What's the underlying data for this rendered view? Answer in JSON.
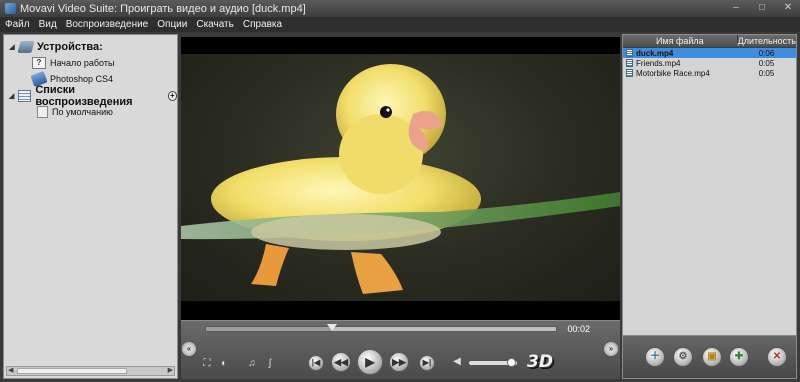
{
  "window": {
    "title": "Movavi Video Suite: Проиграть видео и аудио [duck.mp4]",
    "minimize": "–",
    "maximize": "□",
    "close": "✕"
  },
  "menu": [
    "Файл",
    "Вид",
    "Воспроизведение",
    "Опции",
    "Скачать",
    "Справка"
  ],
  "sidebar": {
    "devices_label": "Устройства:",
    "devices": [
      {
        "label": "Начало работы",
        "icon": "help-icon"
      },
      {
        "label": "Photoshop CS4",
        "icon": "photoshop-icon"
      }
    ],
    "playlists_label": "Списки воспроизведения",
    "playlists": [
      {
        "label": "По умолчанию",
        "icon": "document-icon"
      }
    ]
  },
  "player": {
    "time": "00:02",
    "progress": 0.36,
    "volume": 0.9,
    "badge_3d": "3D"
  },
  "playlist_table": {
    "headers": [
      "Имя файла",
      "Длительность"
    ],
    "rows": [
      {
        "name": "duck.mp4",
        "duration": "0:06",
        "selected": true
      },
      {
        "name": "Friends.mp4",
        "duration": "0:05",
        "selected": false
      },
      {
        "name": "Motorbike Race.mp4",
        "duration": "0:05",
        "selected": false
      }
    ]
  },
  "colors": {
    "selection": "#3d8ee0",
    "panel_bg": "#d9d9d9",
    "chrome_dark": "#3a3a3a"
  }
}
